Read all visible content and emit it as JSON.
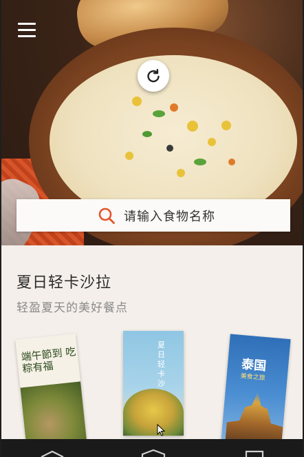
{
  "header": {
    "menu_icon": "hamburger-menu-icon",
    "refresh_icon": "refresh-icon"
  },
  "search": {
    "placeholder": "请输入食物名称",
    "icon": "search-icon",
    "accent_color": "#e4552b"
  },
  "section": {
    "title": "夏日轻卡沙拉",
    "subtitle": "轻盈夏天的美好餐点"
  },
  "cards": [
    {
      "title": "端午節到 吃粽有福",
      "image": "zongzi-photo"
    },
    {
      "title": "夏日轻卡沙拉",
      "image": "corn-salad-photo"
    },
    {
      "title": "泰国",
      "subtitle": "美食之旅",
      "image": "thai-temple-photo"
    }
  ],
  "navbar": {
    "back_icon": "back-icon",
    "home_icon": "home-icon",
    "recent_icon": "recent-apps-icon"
  }
}
